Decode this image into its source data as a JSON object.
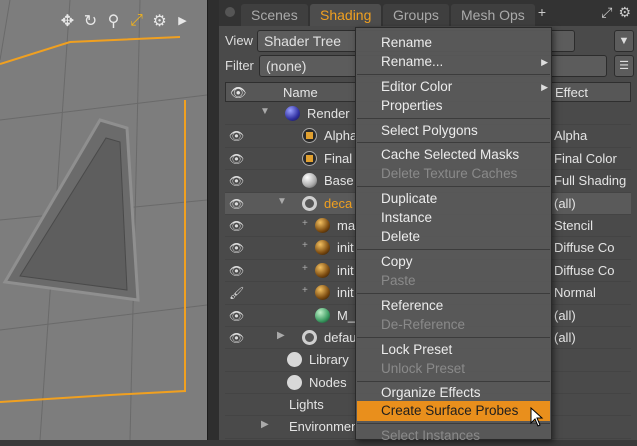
{
  "viewport": {
    "toolbar": [
      "move-icon",
      "rotate-icon",
      "zoom-icon",
      "fit-icon",
      "gear-icon",
      "more-icon"
    ]
  },
  "tabs": [
    "Scenes",
    "Shading",
    "Groups",
    "Mesh Ops"
  ],
  "view": {
    "label": "View",
    "value": "Shader Tree"
  },
  "filter": {
    "label": "Filter",
    "value": "(none)"
  },
  "columns": {
    "name": "Name",
    "effect": "Effect"
  },
  "rows": [
    {
      "name": "Render",
      "effect": ""
    },
    {
      "name": "Alpha",
      "effect": "Alpha"
    },
    {
      "name": "Final",
      "effect": "Final Color"
    },
    {
      "name": "Base",
      "effect": "Full Shading"
    },
    {
      "name": "deca",
      "effect": "(all)"
    },
    {
      "name": "ma",
      "effect": "Stencil"
    },
    {
      "name": "init",
      "effect": "Diffuse Co"
    },
    {
      "name": "init",
      "effect": "Diffuse Co"
    },
    {
      "name": "init",
      "effect": "Normal"
    },
    {
      "name": "M_",
      "effect": "(all)"
    },
    {
      "name": "defau",
      "effect": "(all)"
    },
    {
      "name": "Library",
      "effect": ""
    },
    {
      "name": "Nodes",
      "effect": ""
    },
    {
      "name": "Lights",
      "effect": ""
    },
    {
      "name": "Environmen",
      "effect": ""
    }
  ],
  "menu": {
    "rename": "Rename",
    "rename_more": "Rename...",
    "editor_color": "Editor Color",
    "properties": "Properties",
    "select_polygons": "Select Polygons",
    "cache_selected_masks": "Cache Selected Masks",
    "delete_texture_caches": "Delete Texture Caches",
    "duplicate": "Duplicate",
    "instance": "Instance",
    "delete": "Delete",
    "copy": "Copy",
    "paste": "Paste",
    "reference": "Reference",
    "de_reference": "De-Reference",
    "lock_preset": "Lock Preset",
    "unlock_preset": "Unlock Preset",
    "organize_effects": "Organize Effects",
    "create_surface_probes": "Create Surface Probes",
    "select_instances": "Select Instances"
  },
  "colors": {
    "accent": "#e98f1c",
    "selected_text": "#f0a020"
  }
}
